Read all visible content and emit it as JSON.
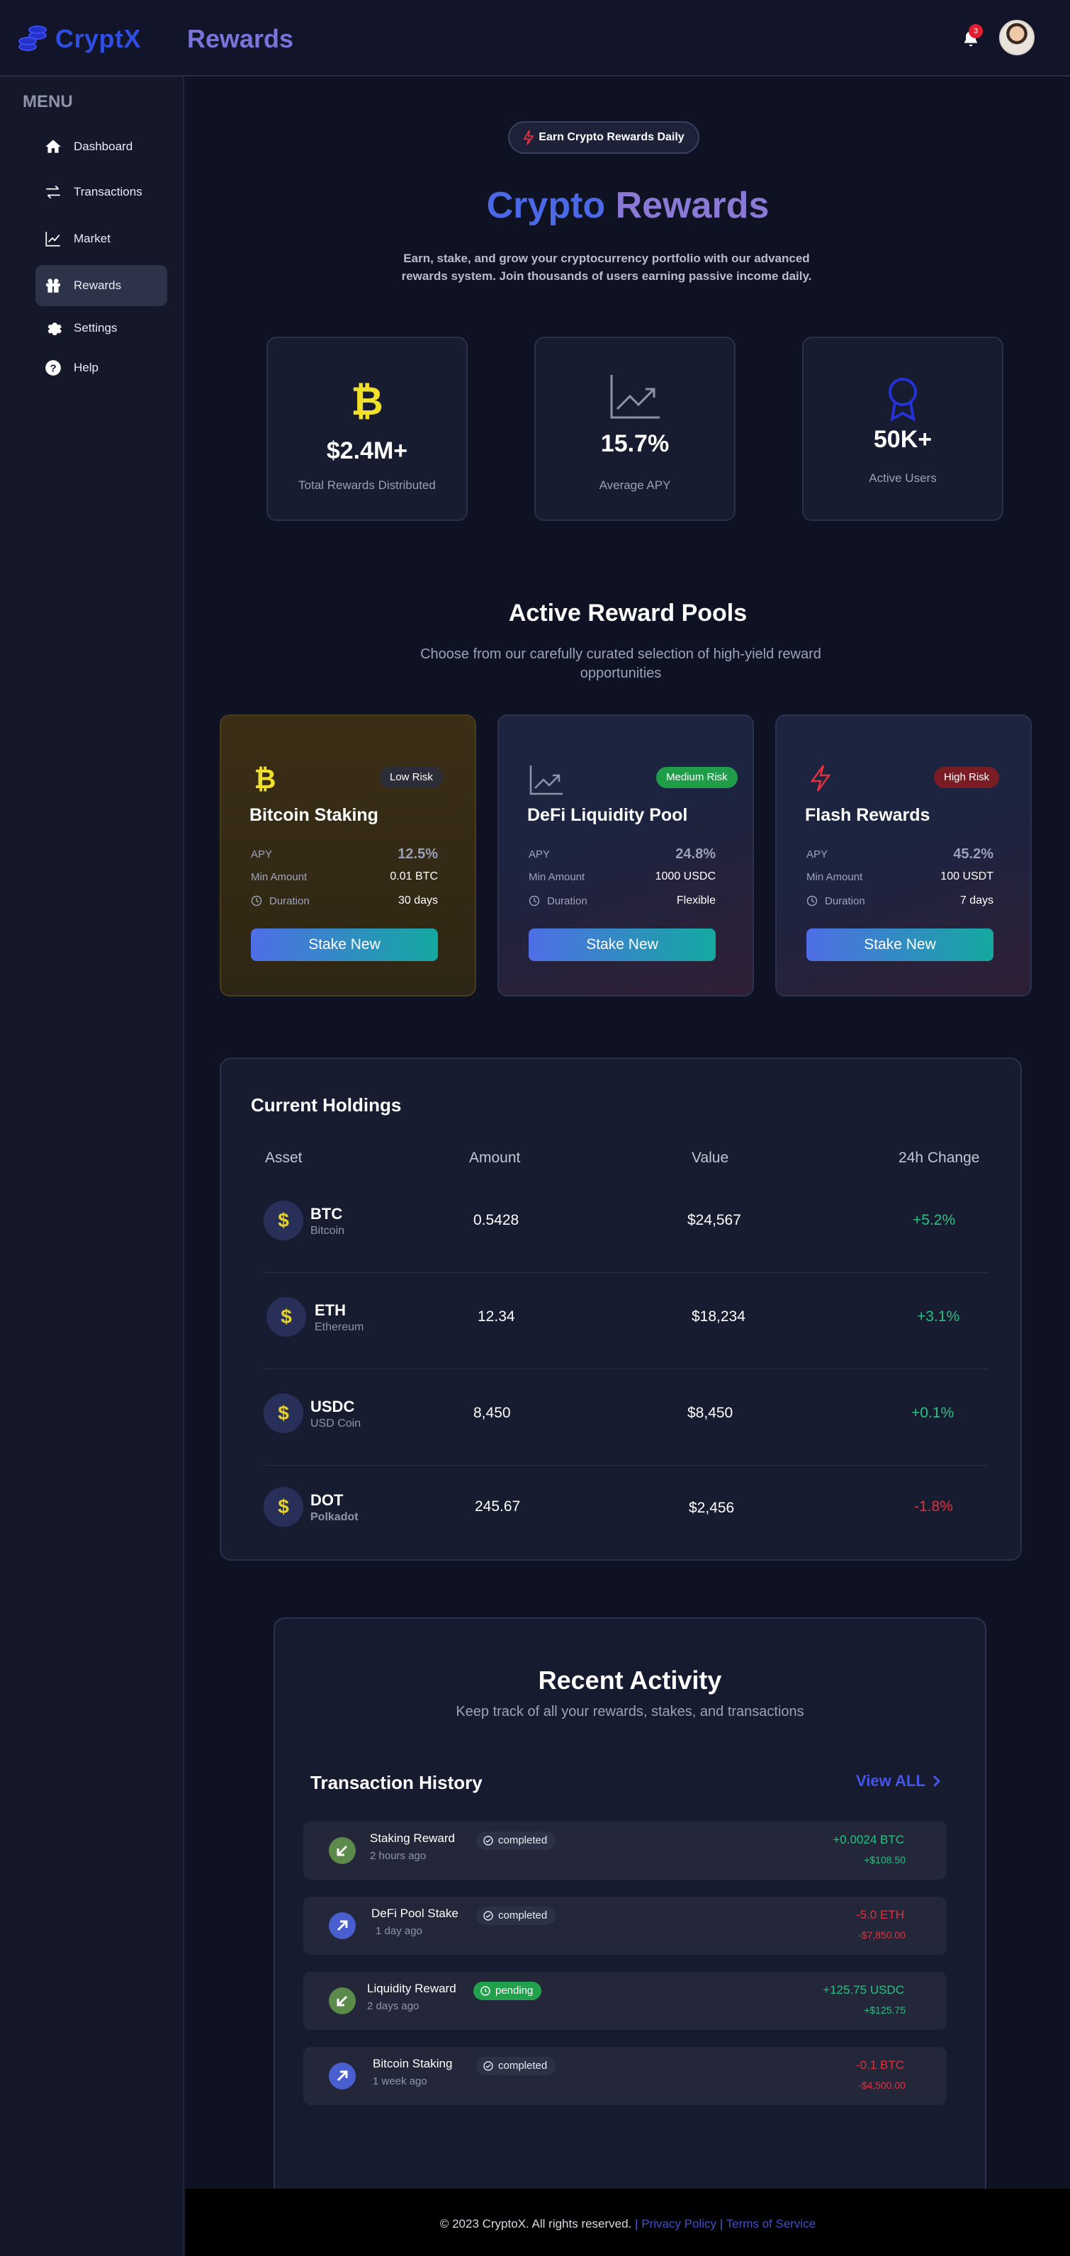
{
  "header": {
    "brand": "CryptX",
    "title": "Rewards",
    "notification_count": "3"
  },
  "sidebar": {
    "menu_label": "MENU",
    "items": [
      {
        "label": "Dashboard",
        "icon": "home-icon"
      },
      {
        "label": "Transactions",
        "icon": "arrows-icon"
      },
      {
        "label": "Market",
        "icon": "chart-icon"
      },
      {
        "label": "Rewards",
        "icon": "gift-icon",
        "active": true
      },
      {
        "label": "Settings",
        "icon": "gear-icon"
      },
      {
        "label": "Help",
        "icon": "help-icon"
      }
    ]
  },
  "hero": {
    "pill": "Earn Crypto Rewards Daily",
    "title_a": "Crypto",
    "title_b": "Rewards",
    "subtitle": "Earn, stake, and grow your cryptocurrency portfolio with our advanced rewards system. Join thousands of users earning passive income daily."
  },
  "stats": [
    {
      "value": "$2.4M+",
      "label": "Total Rewards Distributed",
      "icon": "bitcoin-icon"
    },
    {
      "value": "15.7%",
      "label": "Average APY",
      "icon": "trend-chart-icon"
    },
    {
      "value": "50K+",
      "label": "Active Users",
      "icon": "award-icon"
    }
  ],
  "pools_section": {
    "title": "Active Reward Pools",
    "subtitle": "Choose from our carefully curated selection of high-yield reward opportunities"
  },
  "pools": [
    {
      "name": "Bitcoin Staking",
      "risk": "Low Risk",
      "apy_label": "APY",
      "apy": "12.5%",
      "min_label": "Min Amount",
      "min": "0.01 BTC",
      "duration_label": "Duration",
      "duration": "30 days",
      "button": "Stake New"
    },
    {
      "name": "DeFi Liquidity Pool",
      "risk": "Medium Risk",
      "apy_label": "APY",
      "apy": "24.8%",
      "min_label": "Min Amount",
      "min": "1000 USDC",
      "duration_label": "Duration",
      "duration": "Flexible",
      "button": "Stake New"
    },
    {
      "name": "Flash Rewards",
      "risk": "High Risk",
      "apy_label": "APY",
      "apy": "45.2%",
      "min_label": "Min Amount",
      "min": "100 USDT",
      "duration_label": "Duration",
      "duration": "7 days",
      "button": "Stake New"
    }
  ],
  "holdings": {
    "title": "Current Holdings",
    "columns": [
      "Asset",
      "Amount",
      "Value",
      "24h Change"
    ],
    "rows": [
      {
        "symbol": "BTC",
        "name": "Bitcoin",
        "amount": "0.5428",
        "value": "$24,567",
        "change": "+5.2%"
      },
      {
        "symbol": "ETH",
        "name": "Ethereum",
        "amount": "12.34",
        "value": "$18,234",
        "change": "+3.1%"
      },
      {
        "symbol": "USDC",
        "name": "USD Coin",
        "amount": "8,450",
        "value": "$8,450",
        "change": "+0.1%"
      },
      {
        "symbol": "DOT",
        "name": "Polkadot",
        "amount": "245.67",
        "value": "$2,456",
        "change": "-1.8%"
      }
    ]
  },
  "activity": {
    "title": "Recent Activity",
    "subtitle": "Keep track of all your rewards, stakes, and transactions",
    "history_title": "Transaction History",
    "view_all": "View ALL",
    "items": [
      {
        "name": "Staking Reward",
        "time": "2 hours ago",
        "status": "completed",
        "amount": "+0.0024 BTC",
        "usd": "+$108.50"
      },
      {
        "name": "DeFi Pool Stake",
        "time": "1 day ago",
        "status": "completed",
        "amount": "-5.0 ETH",
        "usd": "-$7,850.00"
      },
      {
        "name": "Liquidity Reward",
        "time": "2 days ago",
        "status": "pending",
        "amount": "+125.75 USDC",
        "usd": "+$125.75"
      },
      {
        "name": "Bitcoin Staking",
        "time": "1 week ago",
        "status": "completed",
        "amount": "-0.1 BTC",
        "usd": "-$4,500.00"
      }
    ]
  },
  "footer": {
    "copyright": "© 2023 CryptoX. All rights reserved.",
    "privacy": "Privacy Policy",
    "terms": "Terms of Service"
  },
  "colors": {
    "accent": "#4556e8",
    "positive": "#26c281",
    "negative": "#e0333f",
    "brand": "#2f4de0"
  }
}
